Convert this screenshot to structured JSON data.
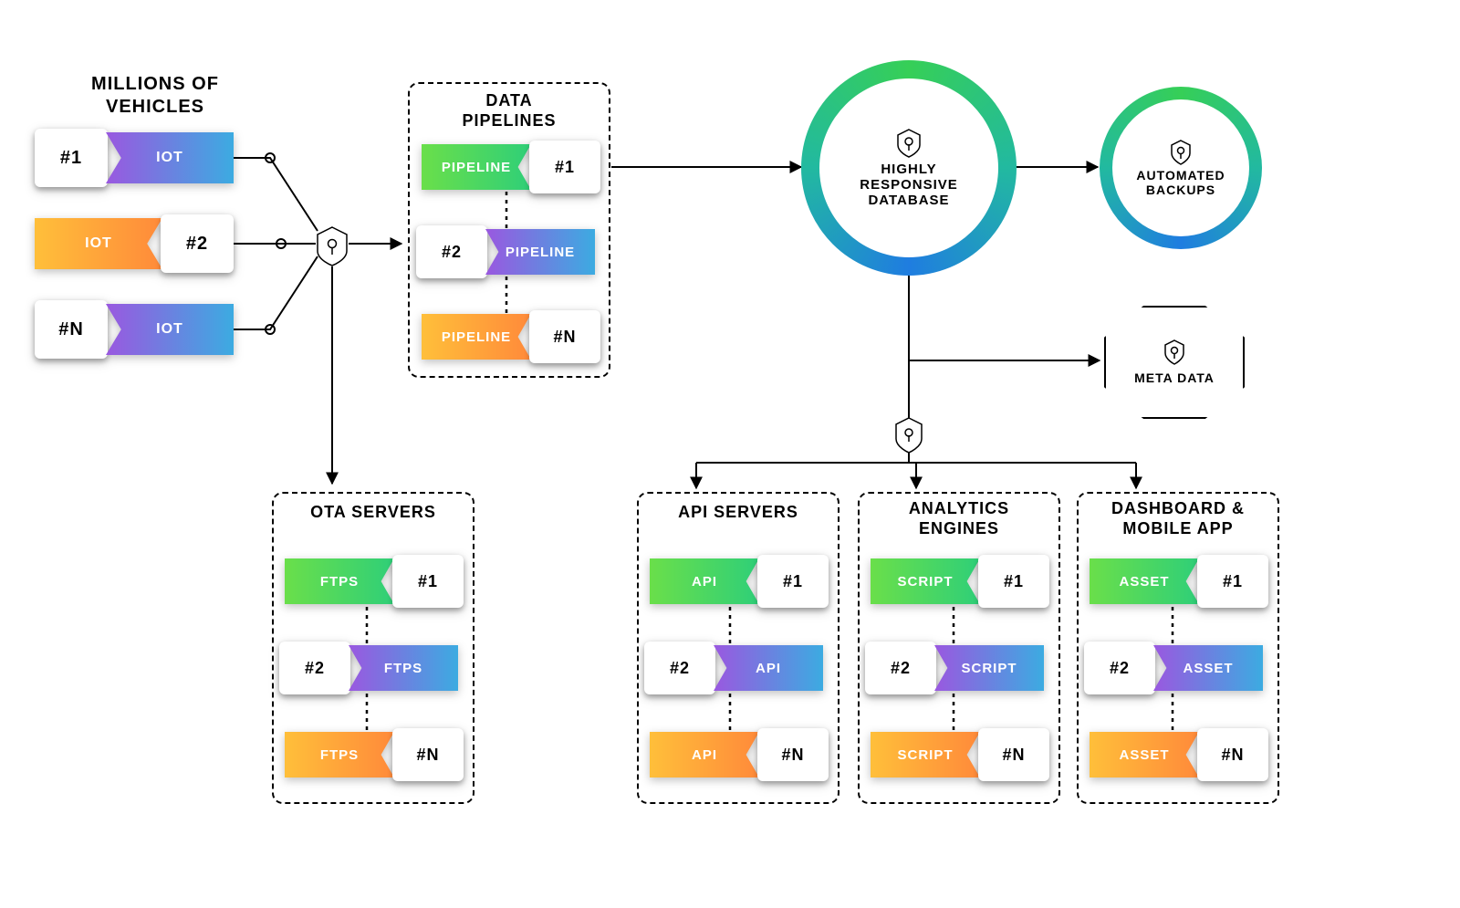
{
  "vehicles": {
    "title": "MILLIONS OF\nVEHICLES",
    "items": [
      {
        "tag": "#1",
        "label": "IOT"
      },
      {
        "tag": "#2",
        "label": "IOT"
      },
      {
        "tag": "#N",
        "label": "IOT"
      }
    ]
  },
  "pipelines": {
    "title": "DATA\nPIPELINES",
    "items": [
      {
        "tag": "#1",
        "label": "PIPELINE"
      },
      {
        "tag": "#2",
        "label": "PIPELINE"
      },
      {
        "tag": "#N",
        "label": "PIPELINE"
      }
    ]
  },
  "ota": {
    "title": "OTA SERVERS",
    "items": [
      {
        "tag": "#1",
        "label": "FTPS"
      },
      {
        "tag": "#2",
        "label": "FTPS"
      },
      {
        "tag": "#N",
        "label": "FTPS"
      }
    ]
  },
  "api": {
    "title": "API SERVERS",
    "items": [
      {
        "tag": "#1",
        "label": "API"
      },
      {
        "tag": "#2",
        "label": "API"
      },
      {
        "tag": "#N",
        "label": "API"
      }
    ]
  },
  "analytics": {
    "title": "ANALYTICS\nENGINES",
    "items": [
      {
        "tag": "#1",
        "label": "SCRIPT"
      },
      {
        "tag": "#2",
        "label": "SCRIPT"
      },
      {
        "tag": "#N",
        "label": "SCRIPT"
      }
    ]
  },
  "dashboard": {
    "title": "DASHBOARD  &\nMOBILE APP",
    "items": [
      {
        "tag": "#1",
        "label": "ASSET"
      },
      {
        "tag": "#2",
        "label": "ASSET"
      },
      {
        "tag": "#N",
        "label": "ASSET"
      }
    ]
  },
  "database": {
    "label": "HIGHLY\nRESPONSIVE\nDATABASE"
  },
  "backups": {
    "label": "AUTOMATED\nBACKUPS"
  },
  "metadata": {
    "label": "META DATA"
  }
}
